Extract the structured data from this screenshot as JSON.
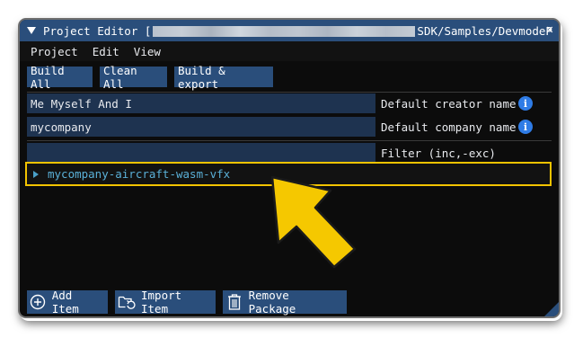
{
  "window": {
    "title_prefix": "Project Editor [",
    "title_suffix": "SDK/Samples/DevmodeP",
    "close_icon": "close-icon"
  },
  "menu": [
    "Project",
    "Edit",
    "View"
  ],
  "toolbar": {
    "build_all": "Build All",
    "clean_all": "Clean All",
    "build_export": "Build & export"
  },
  "fields": {
    "creator_value": "Me Myself And I",
    "creator_label": "Default creator name",
    "company_value": "mycompany",
    "company_label": "Default company name",
    "filter_value": "",
    "filter_label": "Filter (inc,-exc)",
    "info_glyph": "i"
  },
  "tree": {
    "item_label": "mycompany-aircraft-wasm-vfx"
  },
  "bottom": {
    "add_item": "Add Item",
    "import_item": "Import Item",
    "remove_package": "Remove Package"
  },
  "colors": {
    "accent": "#2a4e7b",
    "highlight": "#f2c300",
    "info": "#2f7ce6",
    "tree_text": "#5ab0d8"
  }
}
